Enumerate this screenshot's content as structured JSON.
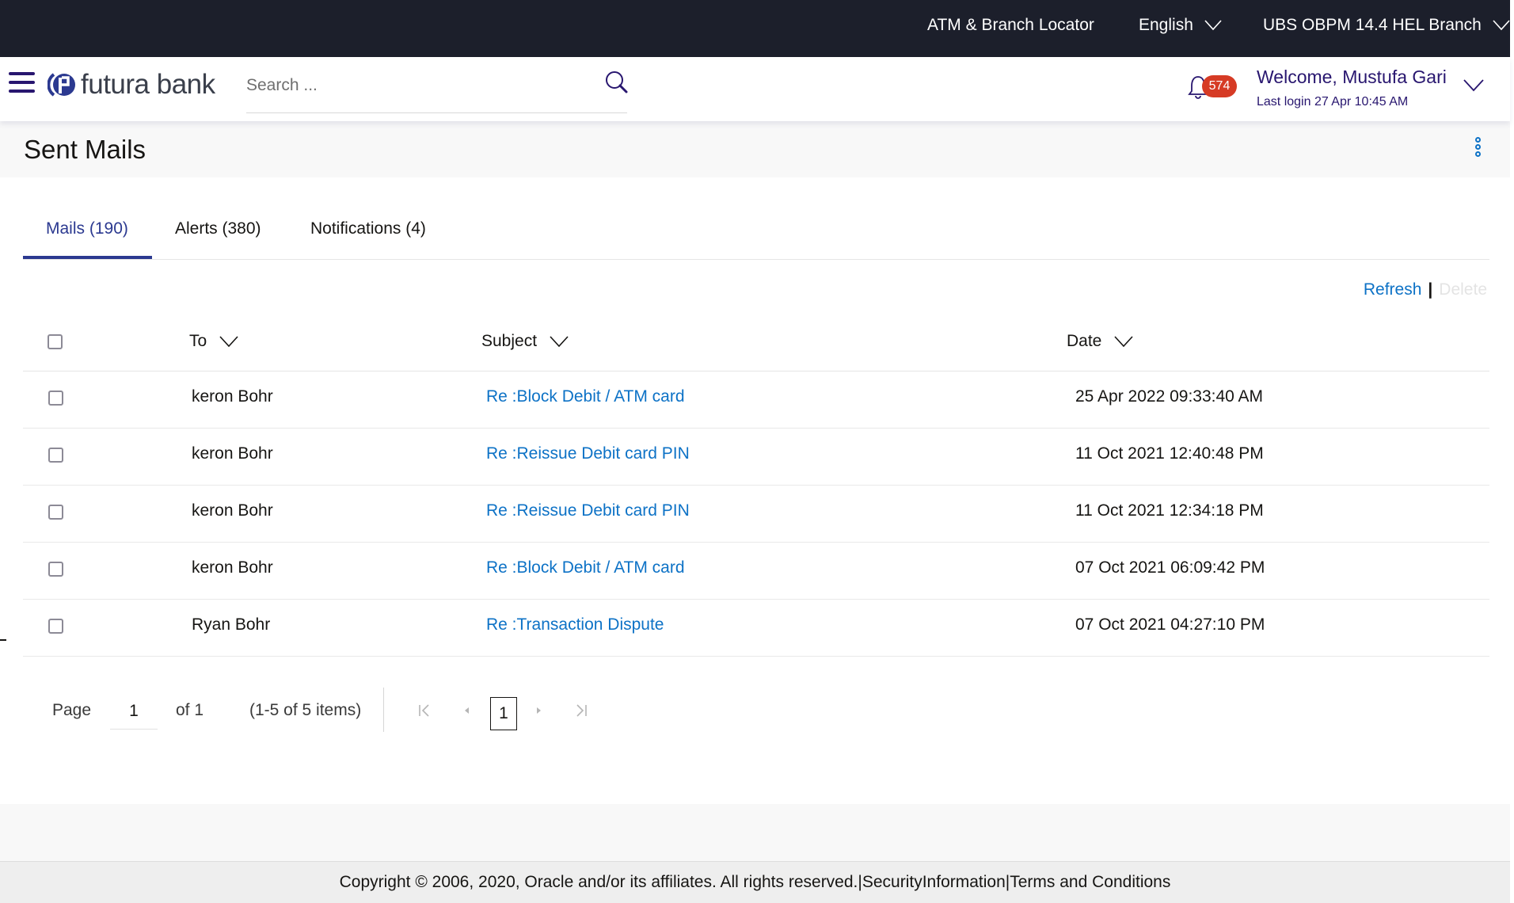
{
  "topbar": {
    "atm_locator": "ATM & Branch Locator",
    "language": "English",
    "branch": "UBS OBPM 14.4 HEL Branch"
  },
  "header": {
    "brand": "futura bank",
    "search_placeholder": "Search ...",
    "notification_count": "574",
    "welcome": "Welcome, Mustufa Gari",
    "last_login": "Last login 27 Apr 10:45 AM"
  },
  "page": {
    "title": "Sent Mails"
  },
  "tabs": [
    {
      "label": "Mails (190)",
      "active": true
    },
    {
      "label": "Alerts (380)",
      "active": false
    },
    {
      "label": "Notifications (4)",
      "active": false
    }
  ],
  "actions": {
    "refresh": "Refresh",
    "separator": "|",
    "delete": "Delete"
  },
  "table": {
    "columns": [
      "To",
      "Subject",
      "Date"
    ],
    "rows": [
      {
        "to": "keron Bohr",
        "subject": "Re :Block Debit / ATM card",
        "date": "25 Apr 2022 09:33:40 AM"
      },
      {
        "to": "keron Bohr",
        "subject": "Re :Reissue Debit card PIN",
        "date": "11 Oct 2021 12:40:48 PM"
      },
      {
        "to": "keron Bohr",
        "subject": "Re :Reissue Debit card PIN",
        "date": "11 Oct 2021 12:34:18 PM"
      },
      {
        "to": "keron Bohr",
        "subject": "Re :Block Debit / ATM card",
        "date": "07 Oct 2021 06:09:42 PM"
      },
      {
        "to": "Ryan Bohr",
        "subject": "Re :Transaction Dispute",
        "date": "07 Oct 2021 04:27:10 PM"
      }
    ]
  },
  "pagination": {
    "page_label": "Page",
    "current_page": "1",
    "of_label": "of 1",
    "items_label": "(1-5 of 5 items)",
    "page_button": "1"
  },
  "footer": {
    "copyright": "Copyright © 2006, 2020, Oracle and/or its affiliates. All rights reserved.",
    "sep1": "|",
    "security": "SecurityInformation",
    "sep2": "|",
    "terms": "Terms and Conditions"
  },
  "colors": {
    "topbar_bg": "#1c1f2b",
    "brand_primary": "#28166f",
    "tab_active": "#2b3990",
    "link": "#0d72c6",
    "badge": "#d63b25",
    "disabled": "#e4e4e4"
  }
}
